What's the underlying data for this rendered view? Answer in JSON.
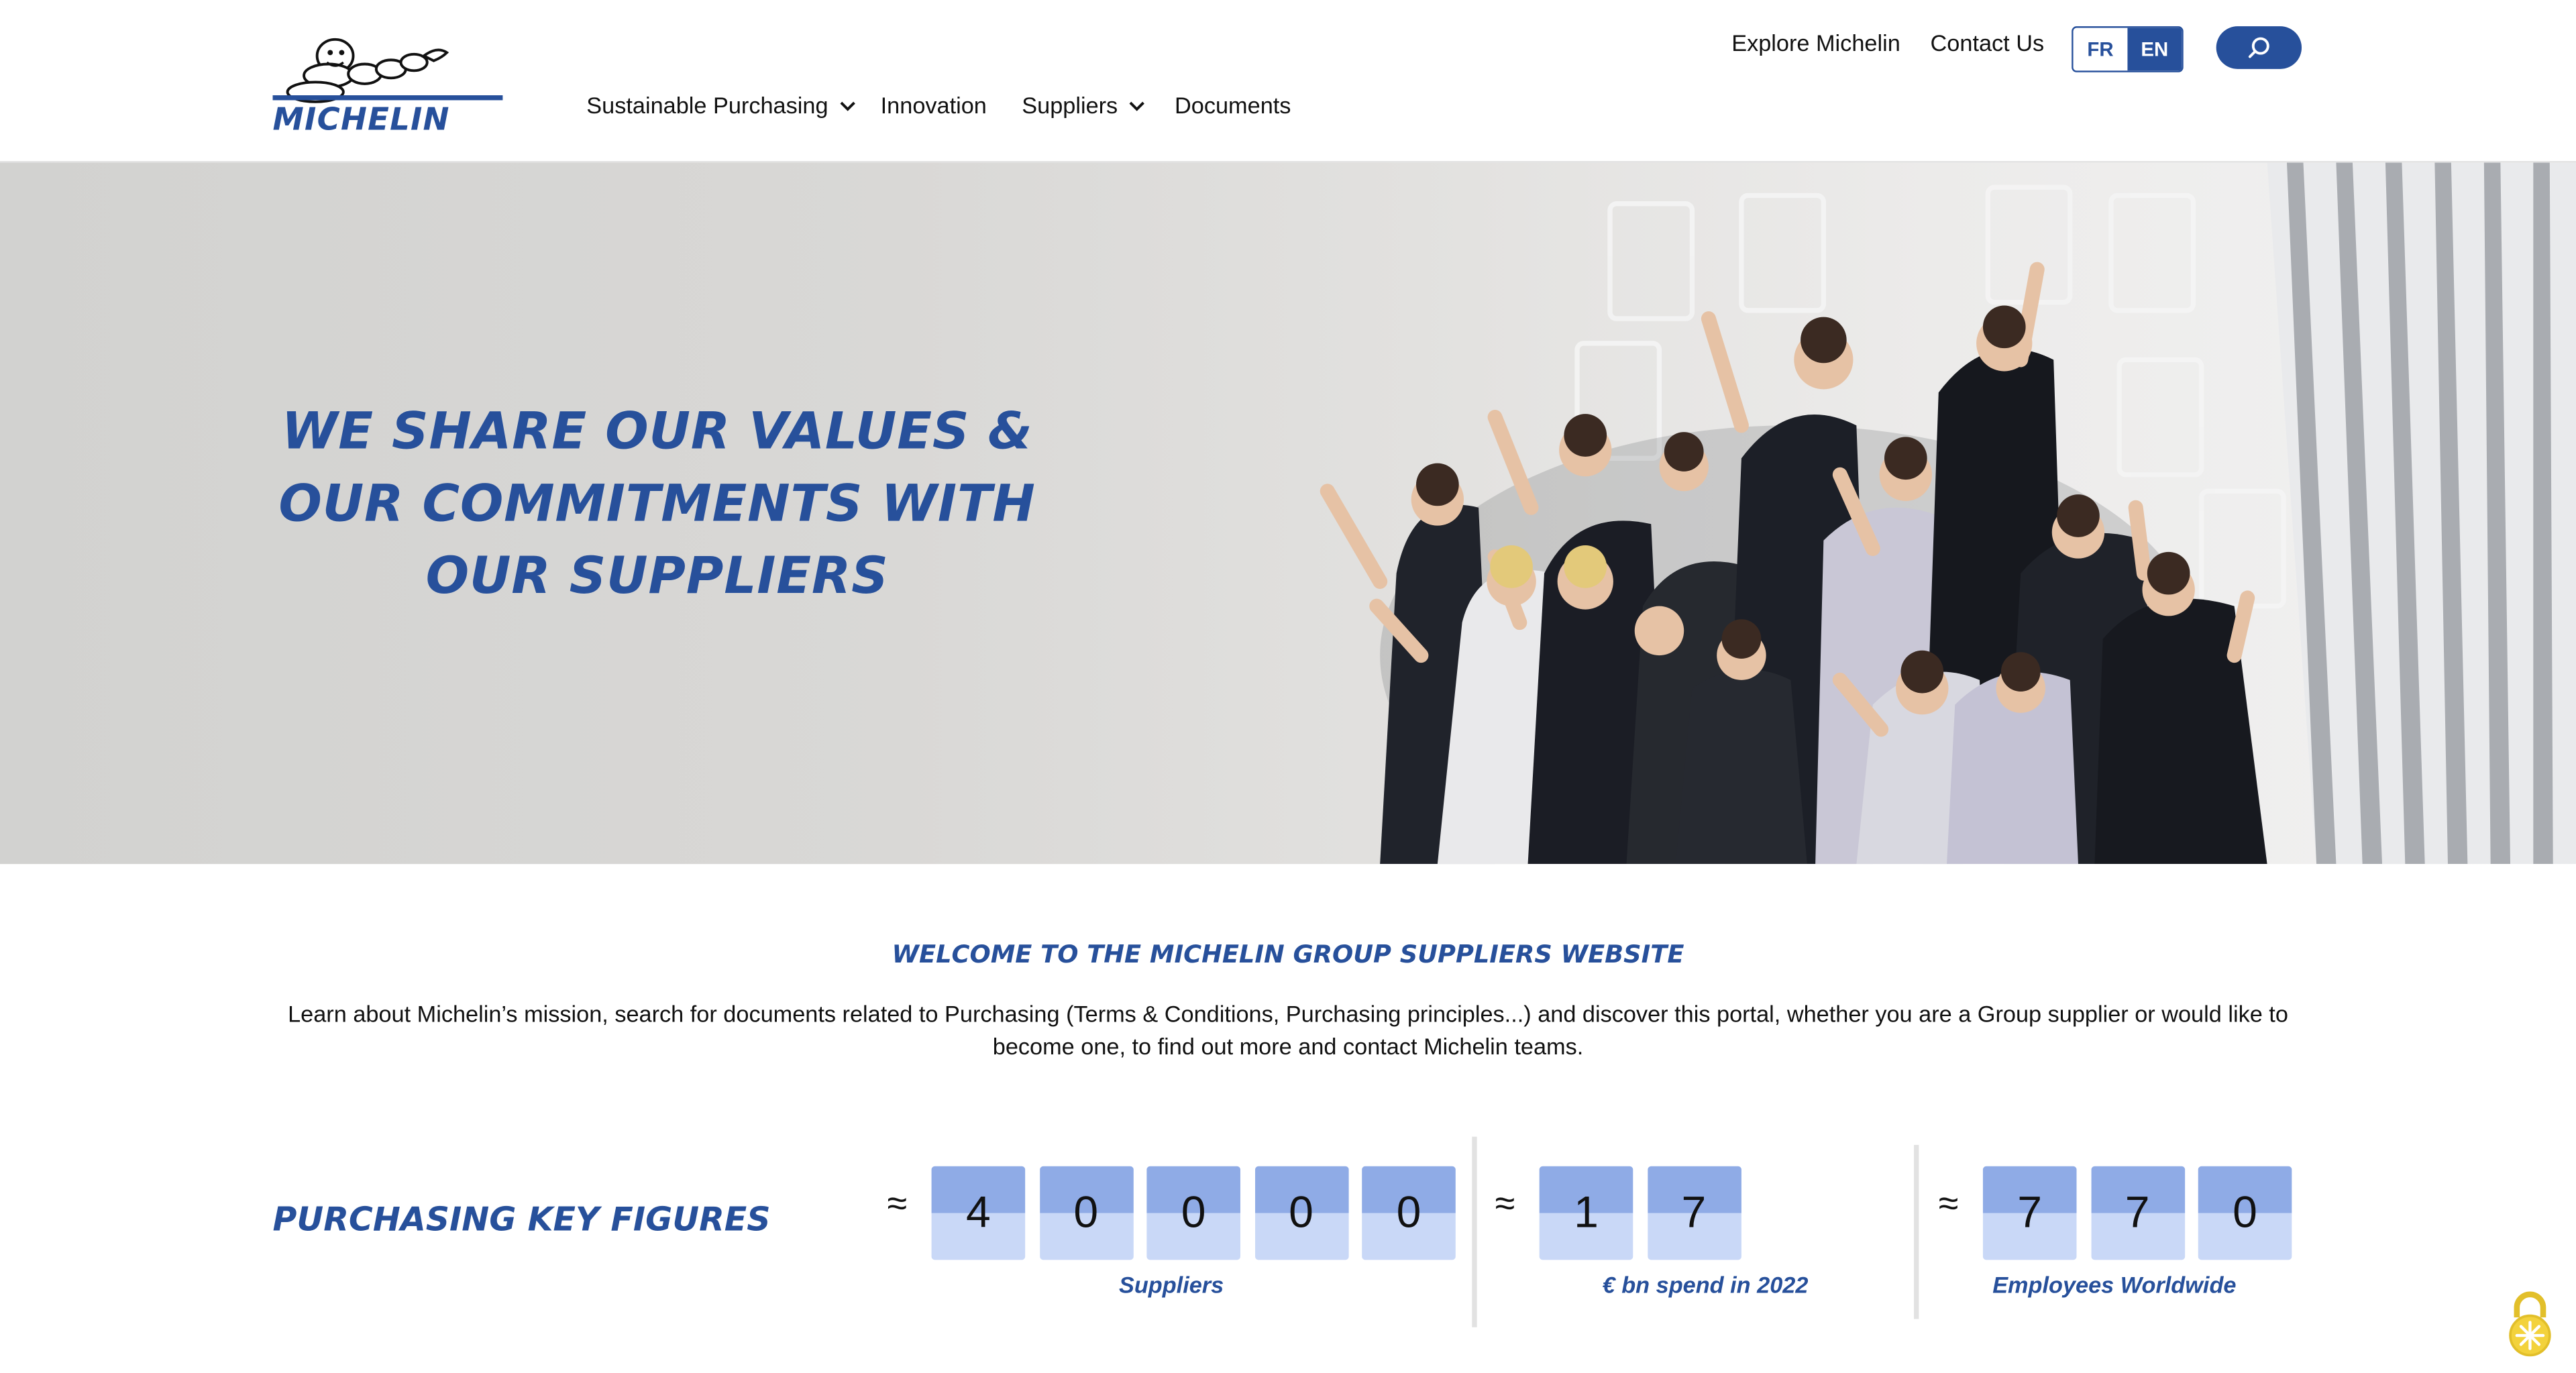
{
  "header": {
    "logo_text": "MICHELIN",
    "explore_link": "Explore Michelin",
    "contact_link": "Contact Us",
    "lang_fr": "FR",
    "lang_en": "EN",
    "lang_active": "EN",
    "nav": [
      {
        "label": "Sustainable Purchasing",
        "has_dropdown": true
      },
      {
        "label": "Innovation",
        "has_dropdown": false
      },
      {
        "label": "Suppliers",
        "has_dropdown": true
      },
      {
        "label": "Documents",
        "has_dropdown": false
      }
    ]
  },
  "hero": {
    "line1": "We share our values &",
    "line2": "our commitments with",
    "line3": "our suppliers"
  },
  "welcome": {
    "title": "Welcome to the Michelin Group suppliers website",
    "text": "Learn about Michelin’s mission, search for documents related to Purchasing (Terms & Conditions, Purchasing principles...) and discover this portal, whether you are a Group supplier or would like to become one, to find out more and contact Michelin teams."
  },
  "key_figures": {
    "title": "Purchasing key figures",
    "approx_symbol": "≈",
    "items": [
      {
        "digits": [
          "4",
          "0",
          "0",
          "0",
          "0"
        ],
        "label": "Suppliers"
      },
      {
        "digits": [
          "1",
          "7"
        ],
        "label": "€ bn spend in 2022"
      },
      {
        "digits": [
          "7",
          "7",
          "0"
        ],
        "label": "Employees Worldwide"
      }
    ]
  },
  "colors": {
    "brand_blue": "#27509b",
    "digit_top": "#8fabe6",
    "digit_bottom": "#c9d8f7",
    "cookie_yellow": "#f3d23c"
  },
  "icons": {
    "search": "magnifier-icon",
    "dropdown": "chevron-down-icon",
    "cookie": "padlock-cookie-icon"
  }
}
